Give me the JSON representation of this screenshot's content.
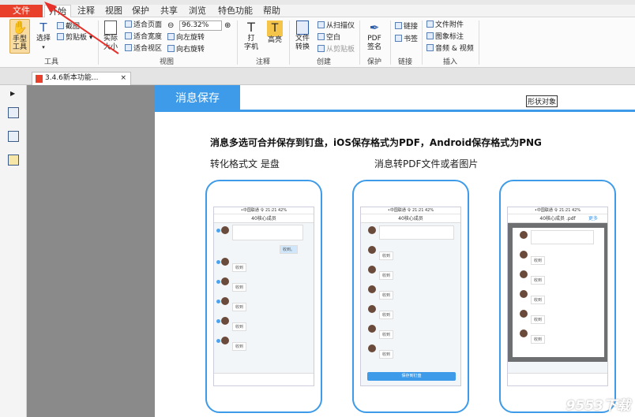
{
  "menu": {
    "file": "文件",
    "home": "开始",
    "annotate": "注释",
    "view": "视图",
    "protect": "保护",
    "share": "共享",
    "browse": "浏览",
    "features": "特色功能",
    "help": "帮助"
  },
  "ribbon": {
    "hand_tool": "手型\n工具",
    "select": "选择",
    "screenshot": "截图",
    "clipboard": "剪贴板",
    "tools_group": "工具",
    "actual_size": "实际\n大小",
    "fit_page": "适合页面",
    "fit_width": "适合宽度",
    "fit_area": "适合视区",
    "zoom": "96.32%",
    "rotate_left": "向左旋转",
    "rotate_right": "向右旋转",
    "view_group": "视图",
    "typewriter": "打\n字机",
    "highlight": "高亮",
    "annotate_group": "注释",
    "convert": "文件\n转换",
    "from_scanner": "从扫描仪",
    "blank": "空白",
    "from_clipboard": "从剪贴板",
    "create_group": "创建",
    "pdf_sign": "PDF\n签名",
    "protect_group": "保护",
    "link": "链接",
    "bookmark": "书签",
    "links_group": "链接",
    "file_attach": "文件附件",
    "image_annot": "图象标注",
    "audio_video": "音频 & 视频",
    "insert_group": "插入"
  },
  "tab": {
    "title": "3.4.6新本功能...",
    "close": "×"
  },
  "document": {
    "banner": "消息保存",
    "shape_label": "形状对象",
    "heading": "消息多选可合并保存到钉盘，iOS保存格式为PDF，Android保存格式为PNG",
    "sub_left": "转化格式文   是盘",
    "sub_right": "消息转PDF文件或者图片",
    "phone1": {
      "status": "•中国联通 令  21:21  42%",
      "title": "40核心成员",
      "send": "收到。"
    },
    "phone2": {
      "status": "•中国联通 令  21:21  42%",
      "title": "40核心成员",
      "save_btn": "保存到钉盘"
    },
    "phone3": {
      "status": "•中国联通 令  21:21  42%",
      "title": "40核心成员 .pdf",
      "more": "更多"
    },
    "reply": "收到",
    "watermark": "9553下载"
  },
  "colors": {
    "accent": "#3d9be9",
    "file_menu": "#e8402a"
  }
}
